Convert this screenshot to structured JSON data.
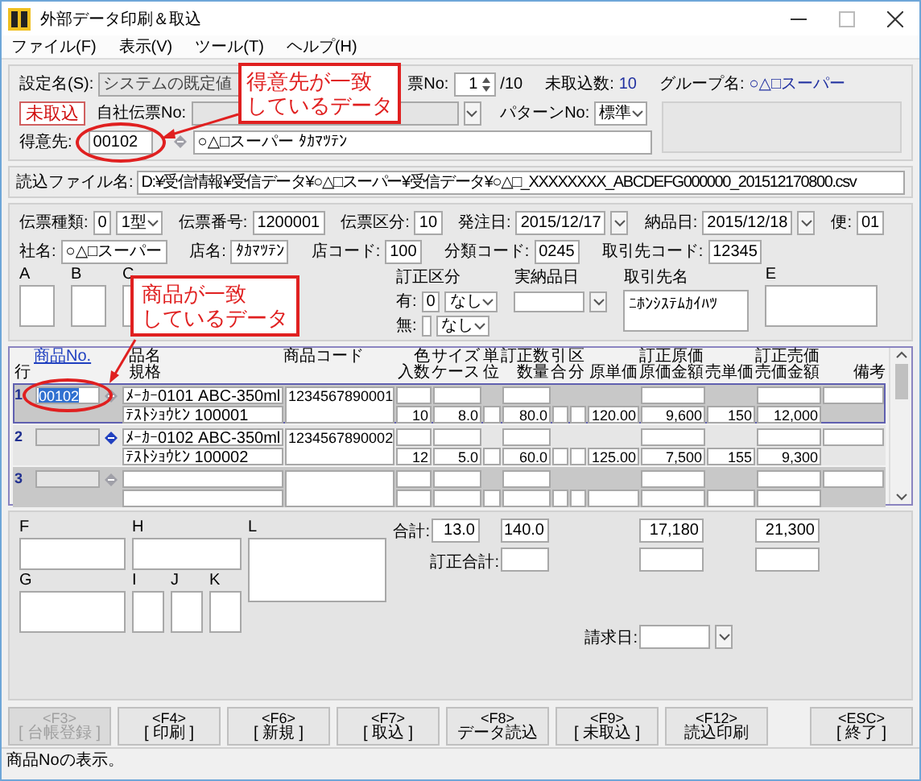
{
  "window": {
    "title": "外部データ印刷＆取込"
  },
  "menu": [
    {
      "label": "ファイル(F)"
    },
    {
      "label": "表示(V)"
    },
    {
      "label": "ツール(T)"
    },
    {
      "label": "ヘルプ(H)"
    }
  ],
  "header": {
    "setting_label": "設定名(S):",
    "setting_value": "システムの既定値",
    "slip_no_label": "票No:",
    "slip_no": "1",
    "slip_total": "/10",
    "pending_label": "未取込数:",
    "pending_count": "10",
    "group_label": "グループ名:",
    "group_name": "○△□スーパー",
    "status_badge": "未取込",
    "own_slip_label": "自社伝票No:",
    "pattern_label": "パターンNo:",
    "pattern_value": "標準",
    "customer_label": "得意先:",
    "customer_code": "00102",
    "customer_name": "○△□スーパー ﾀｶﾏﾂﾃﾝ"
  },
  "file": {
    "label": "読込ファイル名:",
    "value": "D:¥受信情報¥受信データ¥○△□スーパー¥受信データ¥○△□_XXXXXXXX_ABCDEFG000000_201512170800.csv"
  },
  "slip": {
    "type_label": "伝票種類:",
    "type_code": "0",
    "type_value": "1型",
    "number_label": "伝票番号:",
    "number": "1200001",
    "class_label": "伝票区分:",
    "class_value": "10",
    "order_date_label": "発注日:",
    "order_date": "2015/12/17",
    "delivery_date_label": "納品日:",
    "delivery_date": "2015/12/18",
    "flight_label": "便:",
    "flight": "01",
    "company_label": "社名:",
    "company": "○△□スーパー",
    "store_label": "店名:",
    "store": "ﾀｶﾏﾂﾃﾝ",
    "store_code_label": "店コード:",
    "store_code": "100",
    "category_label": "分類コード:",
    "category_code": "0245",
    "partner_code_label": "取引先コード:",
    "partner_code": "12345",
    "box_a": "A",
    "box_b": "B",
    "box_c": "C",
    "correction_label": "訂正区分",
    "corr_yes_label": "有:",
    "corr_yes_code": "0",
    "corr_yes_value": "なし",
    "corr_no_label": "無:",
    "corr_no_value": "なし",
    "actual_date_label": "実納品日",
    "partner_name_label": "取引先名",
    "partner_name": "ﾆﾎﾝｼｽﾃﾑｶｲﾊﾂ",
    "box_e": "E"
  },
  "table": {
    "columns": [
      {
        "label": "行",
        "selected": false
      },
      {
        "label": "商品No.",
        "selected": true
      },
      {
        "top": "品名",
        "bottom": "規格",
        "selected": false
      },
      {
        "label": "商品コード",
        "selected": false
      },
      {
        "top": "色",
        "bottom": "入数",
        "selected": false
      },
      {
        "top": "サイズ",
        "bottom": "ケース",
        "selected": false
      },
      {
        "top": "単",
        "bottom": "位",
        "selected": false
      },
      {
        "top": "訂正数",
        "bottom": "数量",
        "selected": false
      },
      {
        "top": "引",
        "bottom": "合",
        "selected": false
      },
      {
        "top": "区",
        "bottom": "分",
        "selected": false
      },
      {
        "label": "原単価",
        "selected": false
      },
      {
        "top": "訂正原価",
        "bottom": "原価金額",
        "selected": false
      },
      {
        "label": "売単価",
        "selected": false
      },
      {
        "top": "訂正売価",
        "bottom": "売価金額",
        "selected": false
      },
      {
        "label": "備考",
        "selected": false
      }
    ],
    "rows": [
      {
        "no": "1",
        "selected": true,
        "lookup_enabled": false,
        "product_no": "00102",
        "name": "ﾒｰｶｰ0101 ABC-350ml",
        "spec": "ﾃｽﾄｼｮｳﾋﾝ 100001",
        "code": "1234567890001",
        "qty_per": "10",
        "case": "8.0",
        "quantity": "80.0",
        "cost_unit": "120.00",
        "cost_amount": "9,600",
        "sell_unit": "150",
        "sell_amount": "12,000"
      },
      {
        "no": "2",
        "selected": false,
        "lookup_enabled": true,
        "name": "ﾒｰｶｰ0102 ABC-350ml",
        "spec": "ﾃｽﾄｼｮｳﾋﾝ 100002",
        "code": "1234567890002",
        "qty_per": "12",
        "case": "5.0",
        "quantity": "60.0",
        "cost_unit": "125.00",
        "cost_amount": "7,500",
        "sell_unit": "155",
        "sell_amount": "9,300"
      },
      {
        "no": "3",
        "selected": false,
        "lookup_enabled": false
      }
    ]
  },
  "footer": {
    "boxes": [
      "F",
      "H",
      "L",
      "G",
      "I",
      "J",
      "K"
    ],
    "total_label": "合計:",
    "total_case": "13.0",
    "total_quantity": "140.0",
    "total_cost": "17,180",
    "total_sell": "21,300",
    "corrected_total_label": "訂正合計:",
    "billing_date_label": "請求日:"
  },
  "buttons": [
    {
      "key": "<F3>",
      "label": "[ 台帳登録 ]",
      "disabled": true
    },
    {
      "key": "<F4>",
      "label": "[ 印刷 ]",
      "disabled": false
    },
    {
      "key": "<F6>",
      "label": "[ 新規 ]",
      "disabled": false
    },
    {
      "key": "<F7>",
      "label": "[ 取込 ]",
      "disabled": false
    },
    {
      "key": "<F8>",
      "label": "データ読込",
      "disabled": false
    },
    {
      "key": "<F9>",
      "label": "[ 未取込 ]",
      "disabled": false
    },
    {
      "key": "<F12>",
      "label": "読込印刷",
      "disabled": false
    },
    {
      "key": "<ESC>",
      "label": "[ 終了 ]",
      "disabled": false
    }
  ],
  "status_bar": "商品Noの表示。",
  "callouts": [
    {
      "lines": [
        "得意先が一致",
        "しているデータ"
      ]
    },
    {
      "lines": [
        "商品が一致",
        "しているデータ"
      ]
    }
  ]
}
